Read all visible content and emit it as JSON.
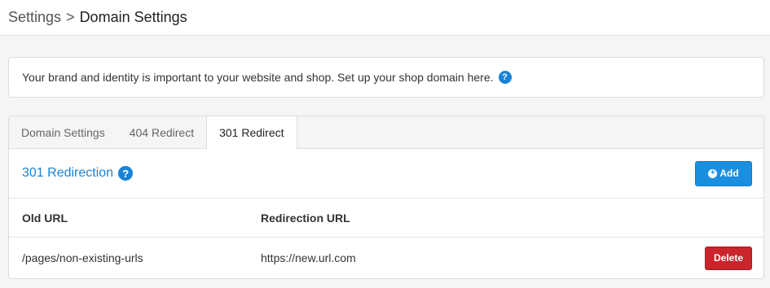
{
  "breadcrumb": {
    "root": "Settings",
    "separator": ">",
    "current": "Domain Settings"
  },
  "info": {
    "text": "Your brand and identity is important to your website and shop. Set up your shop domain here.",
    "help_icon": "question-circle-icon"
  },
  "tabs": [
    {
      "label": "Domain Settings",
      "active": false
    },
    {
      "label": "404 Redirect",
      "active": false
    },
    {
      "label": "301 Redirect",
      "active": true
    }
  ],
  "section": {
    "title": "301 Redirection",
    "help_icon": "question-circle-icon",
    "add_label": "Add",
    "add_icon": "plus-circle-icon"
  },
  "table": {
    "headers": [
      "Old URL",
      "Redirection URL"
    ],
    "rows": [
      {
        "old_url": "/pages/non-existing-urls",
        "redirect_url": "https://new.url.com",
        "action_label": "Delete"
      }
    ]
  },
  "colors": {
    "accent": "#1a83d6",
    "add_button": "#1a8fe0",
    "delete_button": "#c9252b"
  }
}
